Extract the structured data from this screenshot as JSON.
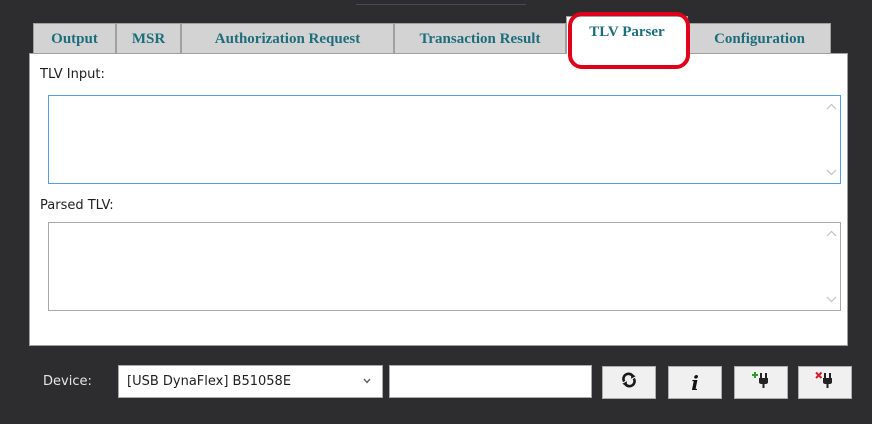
{
  "tabs": [
    {
      "label": "Output",
      "active": false
    },
    {
      "label": "MSR",
      "active": false
    },
    {
      "label": "Authorization Request",
      "active": false
    },
    {
      "label": "Transaction Result",
      "active": false
    },
    {
      "label": "TLV Parser",
      "active": true
    },
    {
      "label": "Configuration",
      "active": false
    }
  ],
  "tlv_parser": {
    "input_label": "TLV Input:",
    "input_value": "",
    "parsed_label": "Parsed TLV:",
    "parsed_value": ""
  },
  "footer": {
    "device_label": "Device:",
    "device_selected": "[USB DynaFlex] B51058E",
    "serial_value": "",
    "buttons": [
      {
        "name": "refresh-button",
        "icon": "refresh-icon"
      },
      {
        "name": "info-button",
        "icon": "info-icon",
        "glyph": "i"
      },
      {
        "name": "connect-button",
        "icon": "plug-connect-icon"
      },
      {
        "name": "disconnect-button",
        "icon": "plug-disconnect-icon"
      }
    ]
  },
  "colors": {
    "tab_text": "#1d6e7d",
    "highlight": "#e0001a",
    "background": "#2d2d30",
    "focus_border": "#569de5",
    "plug_plus": "#2a9d2a",
    "plug_x": "#d0202a"
  }
}
